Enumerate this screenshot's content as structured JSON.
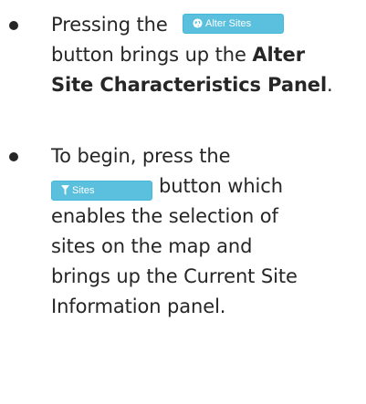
{
  "items": [
    {
      "prefix": "Pressing the",
      "button": {
        "label": "Alter Sites",
        "icon": "globe-icon"
      },
      "line2_text": "button brings up the ",
      "line2_bold": "Alter",
      "line3_bold": "Site Characteristics Panel",
      "line3_tail": "."
    },
    {
      "line1": "To begin, press the",
      "button": {
        "label": "Sites",
        "icon": "filter-icon"
      },
      "line2_tail": "button which",
      "lines": [
        "enables the selection of",
        "sites on the map and",
        "brings up the Current Site",
        "Information panel."
      ]
    }
  ],
  "colors": {
    "button_bg": "#5bc0de",
    "button_border": "#46b8da",
    "text": "#262626"
  }
}
